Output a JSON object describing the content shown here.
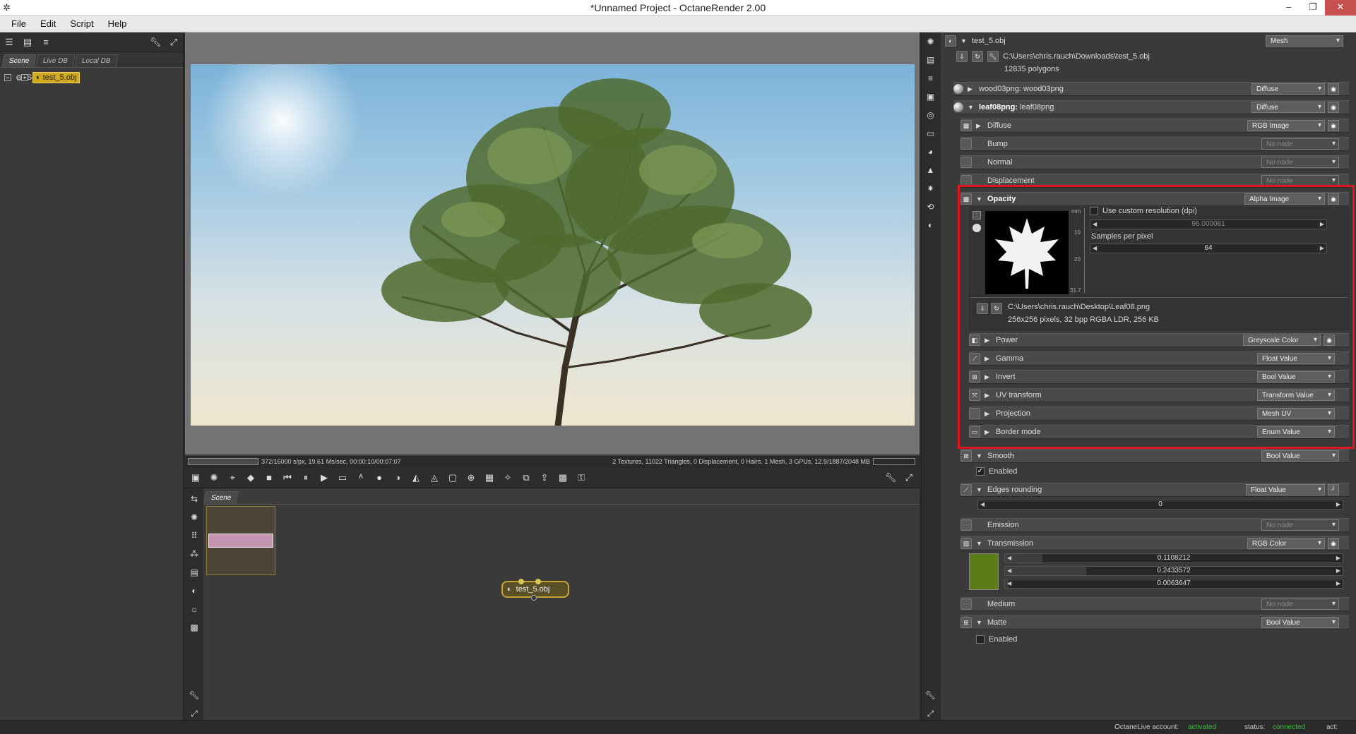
{
  "window": {
    "title": "*Unnamed Project - OctaneRender 2.00"
  },
  "menu": [
    "File",
    "Edit",
    "Script",
    "Help"
  ],
  "left_panel": {
    "tabs": [
      "Scene",
      "Live DB",
      "Local DB"
    ],
    "tree": {
      "root": "Scene",
      "child": "test_5.obj"
    }
  },
  "render_status": {
    "left": "372/16000 s/px, 19.61 Ms/sec, 00:00:10/00:07:07",
    "right": "2 Textures, 11022 Triangles, 0 Displacement, 0 Hairs. 1 Mesh, 3 GPUs, 12.9/1887/2048 MB"
  },
  "node_editor": {
    "tab": "Scene",
    "node_label": "test_5.obj"
  },
  "inspector": {
    "object": {
      "name": "test_5.obj",
      "type": "Mesh",
      "path": "C:\\Users\\chris.rauch\\Downloads\\test_5.obj",
      "polygons": "12835 polygons"
    },
    "materials": [
      {
        "label": "wood03png:",
        "value": "wood03png",
        "type": "Diffuse"
      },
      {
        "label": "leaf08png:",
        "value": "leaf08png",
        "type": "Diffuse"
      }
    ],
    "pins": {
      "diffuse": {
        "label": "Diffuse",
        "type": "RGB Image"
      },
      "bump": {
        "label": "Bump",
        "type": "No node"
      },
      "normal": {
        "label": "Normal",
        "type": "No node"
      },
      "displacement": {
        "label": "Displacement",
        "type": "No node"
      },
      "opacity": {
        "label": "Opacity",
        "type": "Alpha Image"
      }
    },
    "opacity_panel": {
      "units": "mm",
      "ruler": [
        "10",
        "20",
        "31.7"
      ],
      "custom_res_label": "Use custom resolution (dpi)",
      "dpi": "96.000061",
      "spp_label": "Samples per pixel",
      "spp": "64",
      "file_path": "C:\\Users\\chris.rauch\\Desktop\\Leaf08.png",
      "file_info": "256x256 pixels, 32 bpp RGBA LDR, 256 KB"
    },
    "opacity_sub": [
      {
        "label": "Power",
        "type": "Greyscale Color"
      },
      {
        "label": "Gamma",
        "type": "Float Value"
      },
      {
        "label": "Invert",
        "type": "Bool Value"
      },
      {
        "label": "UV transform",
        "type": "Transform Value"
      },
      {
        "label": "Projection",
        "type": "Mesh UV"
      },
      {
        "label": "Border mode",
        "type": "Enum Value"
      }
    ],
    "smooth": {
      "label": "Smooth",
      "type": "Bool Value",
      "enabled": "Enabled"
    },
    "edges": {
      "label": "Edges rounding",
      "type": "Float Value",
      "value": "0"
    },
    "emission": {
      "label": "Emission",
      "type": "No node"
    },
    "transmission": {
      "label": "Transmission",
      "type": "RGB Color",
      "r": "0.1108212",
      "g": "0.2433572",
      "b": "0.0063647",
      "swatch": "#5a7d1a"
    },
    "medium": {
      "label": "Medium",
      "type": "No node"
    },
    "matte": {
      "label": "Matte",
      "type": "Bool Value",
      "enabled": "Enabled"
    }
  },
  "statusbar": {
    "account_label": "OctaneLive account:",
    "account_value": "activated",
    "status_label": "status:",
    "status_value": "connected",
    "act_label": "act:"
  }
}
